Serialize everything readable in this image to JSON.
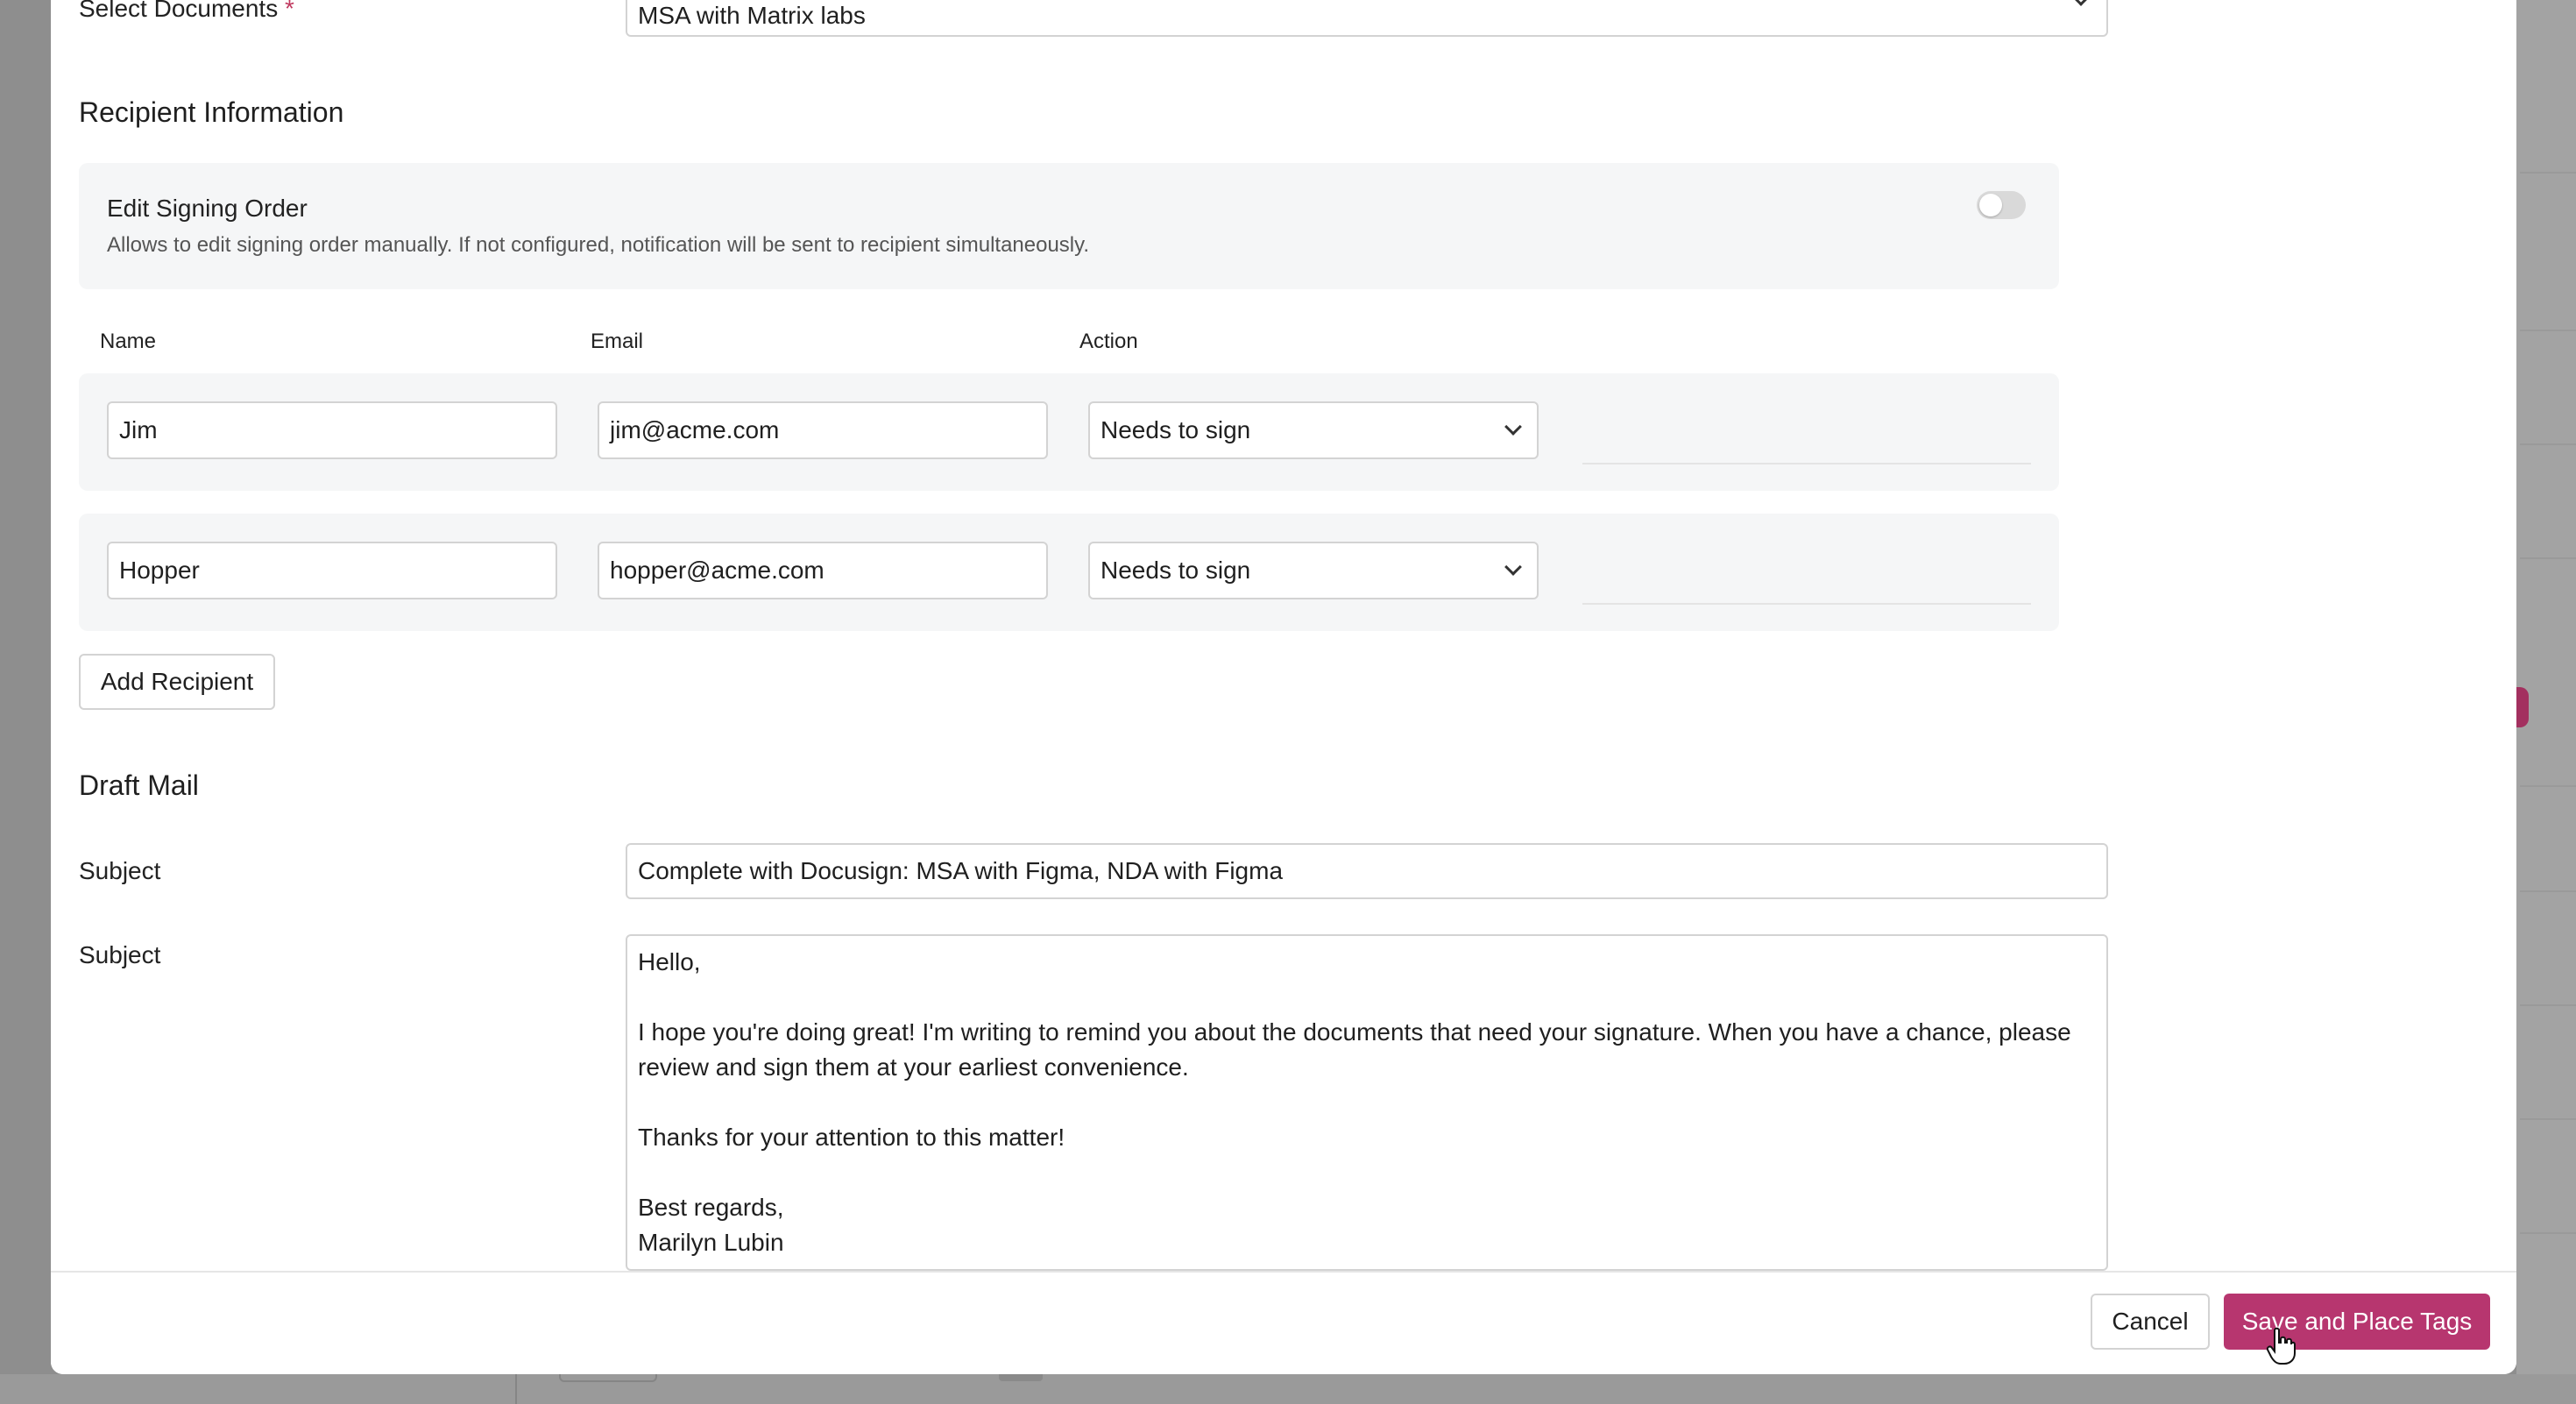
{
  "select_documents": {
    "label": "Select Documents",
    "required_mark": "*",
    "value": "MSA with Matrix labs"
  },
  "recipient_info": {
    "title": "Recipient Information",
    "signing_order": {
      "title": "Edit Signing Order",
      "hint": "Allows to edit signing order manually. If not configured, notification will be sent to recipient simultaneously.",
      "enabled": false
    },
    "columns": {
      "name": "Name",
      "email": "Email",
      "action": "Action"
    },
    "recipients": [
      {
        "name": "Jim",
        "email": "jim@acme.com",
        "action": "Needs to sign"
      },
      {
        "name": "Hopper",
        "email": "hopper@acme.com",
        "action": "Needs to sign"
      }
    ],
    "add_button": "Add Recipient"
  },
  "draft_mail": {
    "title": "Draft Mail",
    "subject_label": "Subject",
    "subject_value": "Complete with Docusign: MSA with Figma, NDA with Figma",
    "body_label": "Subject",
    "body_value": "Hello,\n\nI hope you're doing great! I'm writing to remind you about the documents that need your signature. When you have a chance, please review and sign them at your earliest convenience.\n\nThanks for your attention to this matter!\n\nBest regards,\nMarilyn Lubin"
  },
  "footer": {
    "cancel": "Cancel",
    "save": "Save and Place Tags"
  },
  "colors": {
    "primary": "#b7366f",
    "required": "#c0395f",
    "panel": "#f5f6f7"
  }
}
